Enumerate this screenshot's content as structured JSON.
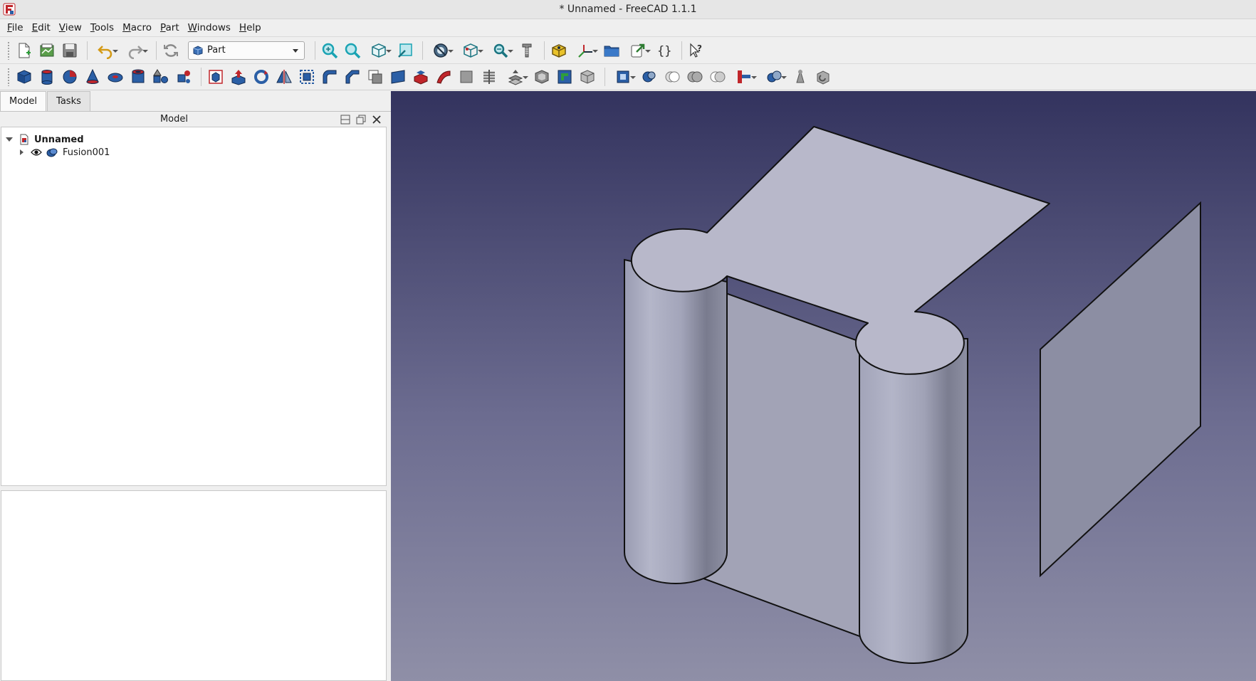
{
  "window": {
    "title": "* Unnamed - FreeCAD 1.1.1"
  },
  "menu": [
    "File",
    "Edit",
    "View",
    "Tools",
    "Macro",
    "Part",
    "Windows",
    "Help"
  ],
  "toolbar": {
    "workbench_selector": "Part"
  },
  "left_panel": {
    "tabs": [
      "Model",
      "Tasks"
    ],
    "active_tab": "Model",
    "panel_title": "Model",
    "tree": {
      "document": "Unnamed",
      "children": [
        {
          "label": "Fusion001",
          "visible": true
        }
      ]
    }
  },
  "icons": {
    "doc": "document-icon",
    "solid": "part-solid-icon",
    "visibility": "eye-icon"
  },
  "colors": {
    "viewport_top": "#33335e",
    "viewport_bottom": "#8f8fa7",
    "part_face": "#b8b8ca",
    "part_side": "#9fa0b3",
    "accent_teal": "#1aa3b3",
    "accent_red": "#c0262b",
    "accent_blue": "#2b5fa6"
  }
}
